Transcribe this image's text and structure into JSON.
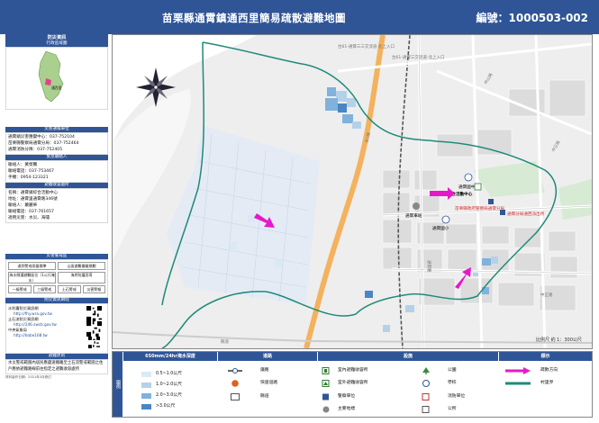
{
  "header": {
    "title": "苗栗縣通霄鎮通西里簡易疏散避難地圖",
    "code": "編號：1000503-002"
  },
  "sidebar": {
    "disaster_info": "防災資訊",
    "admin_area": "行政區域圖",
    "location_label": "通西里",
    "contact_title": "災害通報單位",
    "contacts": [
      "通霄鎮災害應變中心：037-752104",
      "苗栗縣警察局通霄分局：037-752464",
      "通霄消防分隊：037-752405"
    ],
    "person_title": "緊急聯絡人",
    "persons": [
      "聯絡人：黃榮騰",
      "聯絡電話：037-753467",
      "手機：0954-123321"
    ],
    "shelter_title": "避難收容處所",
    "shelters": [
      "名稱：通霄鎮綜合活動中心",
      "地址：通霄里通霄路346號",
      "聯絡人：蕭麗華",
      "聯絡電話：037-761657",
      "適用災害：水災、海嘯"
    ],
    "warning_title": "災害警戒區",
    "warning_rows": [
      [
        "達到警戒雨量標準",
        "山區避難撤離規劃"
      ],
      [
        "海水倒灌避難區位（1公尺淹水）",
        "海岸防護宣導"
      ],
      [
        "一級警戒",
        "三級警戒",
        "土石警戒",
        "災害警報"
      ]
    ],
    "links_title": "防災資訊網站",
    "links": [
      "水利署防災資訊網",
      "http://fhy.wra.gov.tw",
      "土石流防災資訊網",
      "http://246.swcb.gov.tw",
      "中央氣象局",
      "http://bobe168.tw"
    ],
    "note_title": "避難原則",
    "note": "水災警戒範圍內居民應盡速撤離至土石流警戒範圍之住戶應依避難路線前往指定之避難收容處所",
    "footnote": "資料製作日期：2021年3月修訂"
  },
  "map": {
    "roads": [
      "台61-通霄三三交流道-北上入口",
      "台61-通霄三交流道-北上入口",
      "中山路",
      "中正路",
      "中正路",
      "通霄路",
      "台1線",
      "縣道"
    ],
    "pois": [
      {
        "label": "通霄國中",
        "icon": "school"
      },
      {
        "label": "通霄鎮綜合活動中心",
        "icon": "shelter"
      },
      {
        "label": "苗栗縣政府警察局通霄分局",
        "icon": "police"
      },
      {
        "label": "通霄分局通西派出所",
        "icon": "police"
      },
      {
        "label": "通霄國小",
        "icon": "school"
      },
      {
        "label": "通霄車站",
        "icon": "station"
      }
    ],
    "scale": "比例尺 約 1：300公尺"
  },
  "legend": {
    "left_title": "圖例",
    "flood_title": "650mm/24hr淹水深度",
    "flood_classes": [
      "0.5~1.0公尺",
      "1.0~2.0公尺",
      "2.0~3.0公尺",
      ">3.0公尺"
    ],
    "flood_colors": [
      "#dbe9f4",
      "#b3d2ea",
      "#80b2dc",
      "#4a86c4"
    ],
    "road_title": "道路",
    "road_items": [
      "鐵路",
      "快速道路",
      "縣道"
    ],
    "facility_title": "設施",
    "facility_items": [
      "室內避難收容所",
      "室外避難收容所",
      "警察單位",
      "主要地標",
      "公園",
      "學校",
      "消防單位",
      "公所"
    ],
    "mark_title": "標示",
    "mark_items": [
      "疏散方向",
      "村里界"
    ],
    "accent": "#2f5597",
    "arrow_color": "#e619c8",
    "boundary_color": "#1f8a7a"
  }
}
